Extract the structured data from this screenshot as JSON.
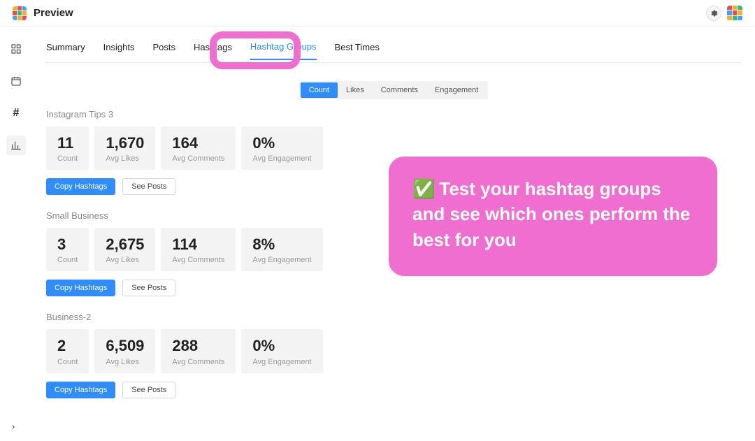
{
  "header": {
    "app_title": "Preview"
  },
  "tabs": {
    "summary": "Summary",
    "insights": "Insights",
    "posts": "Posts",
    "hashtags": "Hashtags",
    "hashtag_groups": "Hashtag Groups",
    "best_times": "Best Times"
  },
  "segments": {
    "count": "Count",
    "likes": "Likes",
    "comments": "Comments",
    "engagement": "Engagement"
  },
  "card_labels": {
    "count": "Count",
    "avg_likes": "Avg Likes",
    "avg_comments": "Avg Comments",
    "avg_engagement": "Avg Engagement"
  },
  "buttons": {
    "copy_hashtags": "Copy Hashtags",
    "see_posts": "See Posts"
  },
  "groups": [
    {
      "title": "Instagram Tips 3",
      "count": "11",
      "avg_likes": "1,670",
      "avg_comments": "164",
      "avg_engagement": "0%"
    },
    {
      "title": "Small Business",
      "count": "3",
      "avg_likes": "2,675",
      "avg_comments": "114",
      "avg_engagement": "8%"
    },
    {
      "title": "Business-2",
      "count": "2",
      "avg_likes": "6,509",
      "avg_comments": "288",
      "avg_engagement": "0%"
    }
  ],
  "callout": {
    "check": "✅",
    "text": "Test your hashtag groups and see which ones perform the best for you"
  }
}
